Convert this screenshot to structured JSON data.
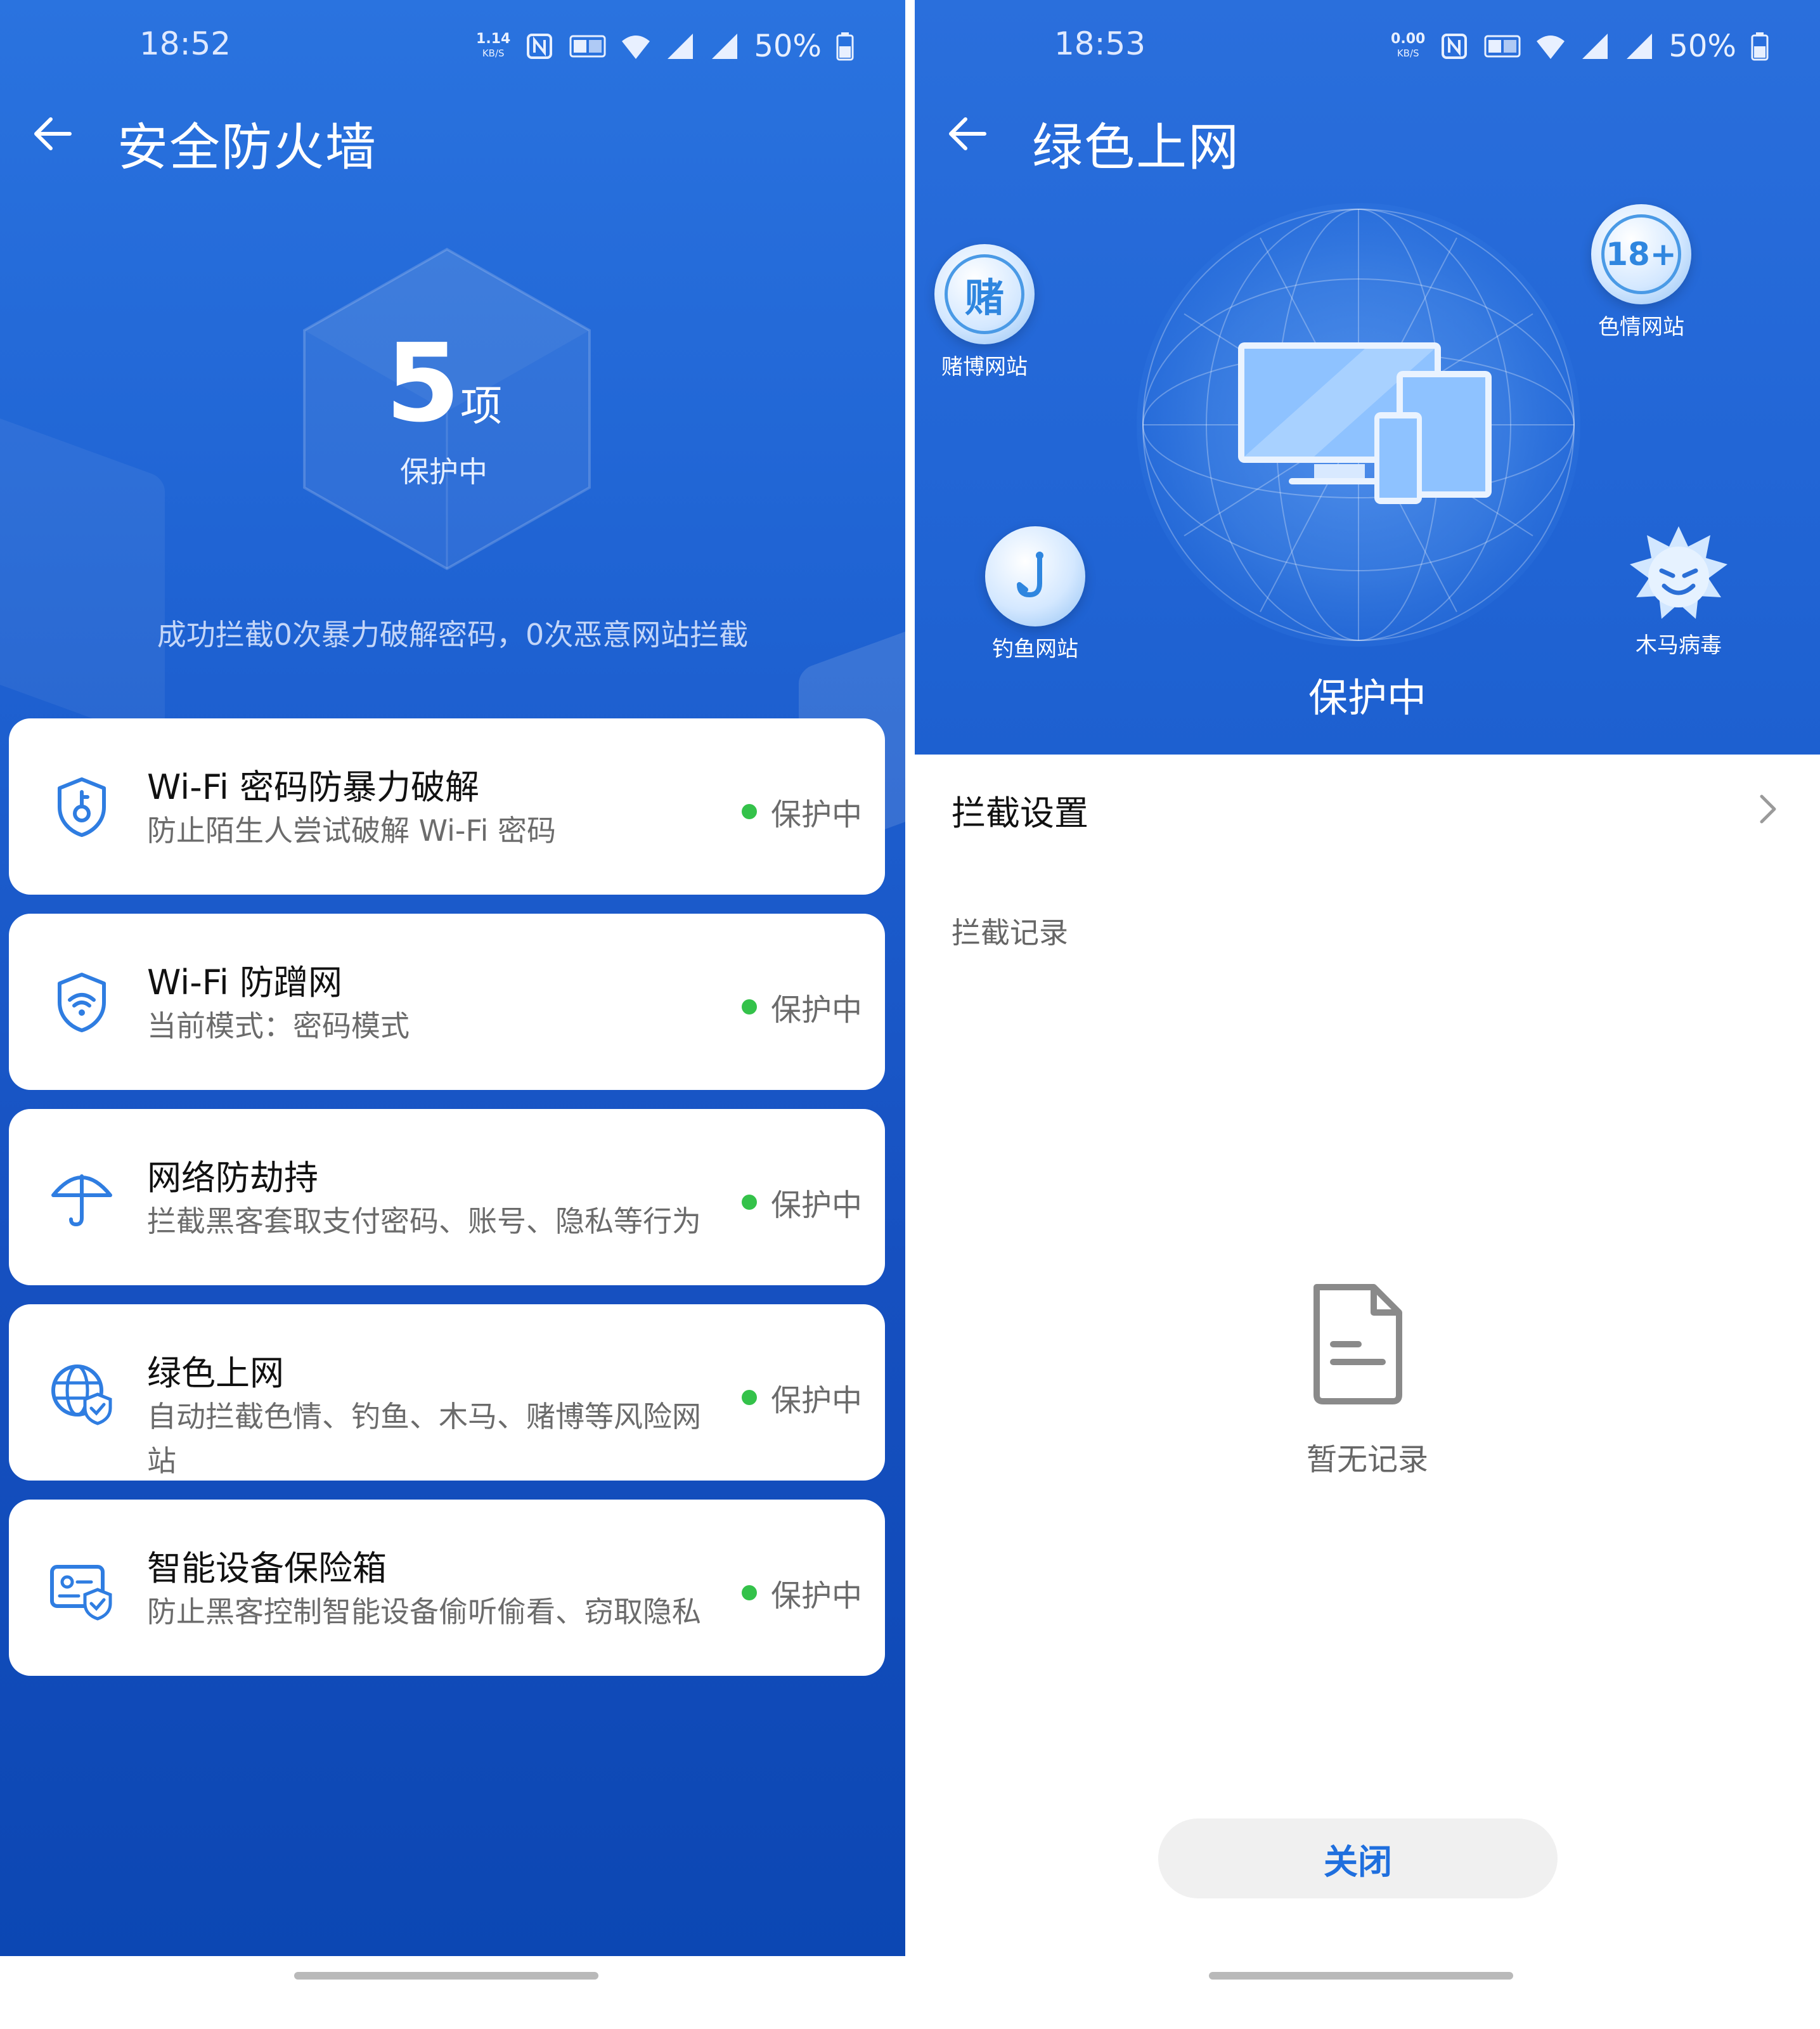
{
  "left": {
    "status_bar": {
      "time": "18:52",
      "net_speed": "1.14",
      "net_unit": "KB/S",
      "battery": "50%"
    },
    "title": "安全防火墙",
    "summary": {
      "count": "5",
      "unit": "项",
      "status": "保护中",
      "intercept_text": "成功拦截0次暴力破解密码，0次恶意网站拦截"
    },
    "features": [
      {
        "title": "Wi-Fi 密码防暴力破解",
        "desc": "防止陌生人尝试破解 Wi-Fi 密码",
        "status": "保护中",
        "icon": "shield-key-icon"
      },
      {
        "title": "Wi-Fi 防蹭网",
        "desc": "当前模式：密码模式",
        "status": "保护中",
        "icon": "shield-wifi-icon"
      },
      {
        "title": "网络防劫持",
        "desc": "拦截黑客套取支付密码、账号、隐私等行为",
        "status": "保护中",
        "icon": "umbrella-icon"
      },
      {
        "title": "绿色上网",
        "desc": "自动拦截色情、钓鱼、木马、赌博等风险网站",
        "status": "保护中",
        "icon": "globe-shield-icon"
      },
      {
        "title": "智能设备保险箱",
        "desc": "防止黑客控制智能设备偷听偷看、窃取隐私",
        "status": "保护中",
        "icon": "device-shield-icon"
      }
    ],
    "colors": {
      "status_dot": "#34c24a",
      "header_blue": "#2a73df"
    }
  },
  "right": {
    "status_bar": {
      "time": "18:53",
      "net_speed": "0.00",
      "net_unit": "KB/S",
      "battery": "50%"
    },
    "title": "绿色上网",
    "badges": {
      "gambling": {
        "glyph": "赌",
        "label": "赌博网站"
      },
      "adult": {
        "glyph": "18+",
        "label": "色情网站"
      },
      "phishing": {
        "label": "钓鱼网站"
      },
      "trojan": {
        "label": "木马病毒"
      }
    },
    "status": "保护中",
    "settings_label": "拦截设置",
    "records_label": "拦截记录",
    "empty_text": "暂无记录",
    "close_label": "关闭",
    "colors": {
      "accent": "#1f6fde"
    }
  }
}
